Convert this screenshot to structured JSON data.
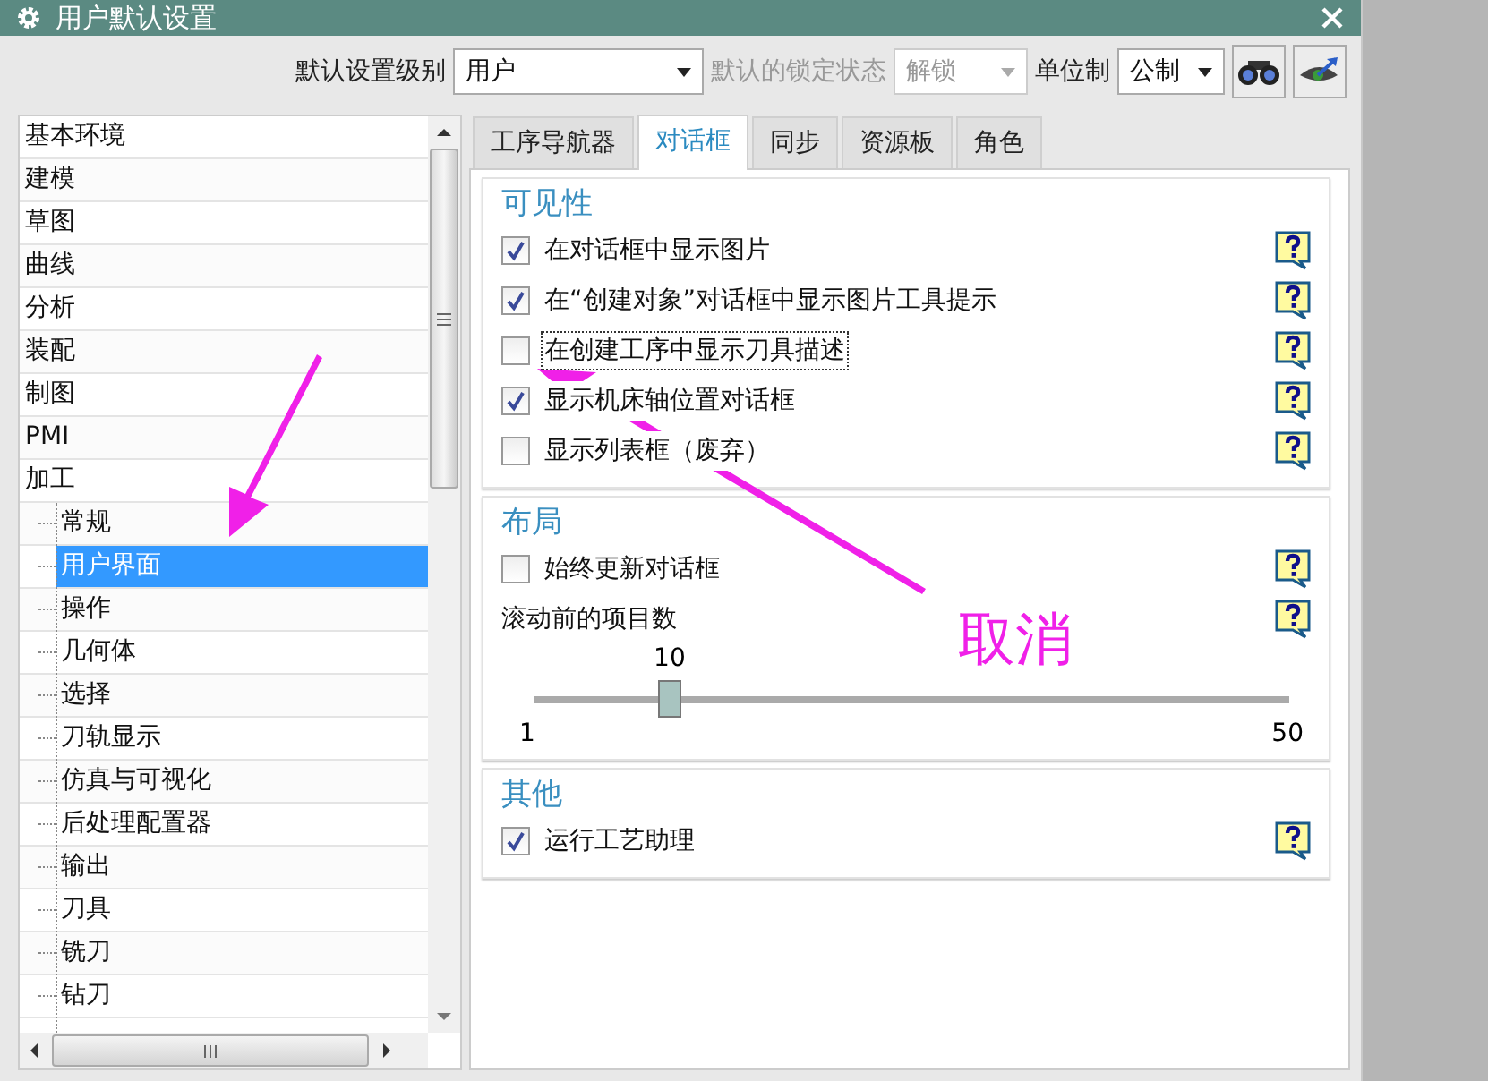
{
  "window": {
    "title": "用户默认设置"
  },
  "toolbar": {
    "level_label": "默认设置级别",
    "level_value": "用户",
    "lock_label": "默认的锁定状态",
    "lock_value": "解锁",
    "lock_disabled": true,
    "unit_label": "单位制",
    "unit_value": "公制"
  },
  "tree": [
    {
      "label": "基本环境",
      "selected": false
    },
    {
      "label": "建模",
      "selected": false
    },
    {
      "label": "草图",
      "selected": false
    },
    {
      "label": "曲线",
      "selected": false
    },
    {
      "label": "分析",
      "selected": false
    },
    {
      "label": "装配",
      "selected": false
    },
    {
      "label": "制图",
      "selected": false
    },
    {
      "label": "PMI",
      "selected": false
    },
    {
      "label": "加工",
      "selected": false,
      "children": [
        {
          "label": "常规",
          "selected": false
        },
        {
          "label": "用户界面",
          "selected": true
        },
        {
          "label": "操作",
          "selected": false
        },
        {
          "label": "几何体",
          "selected": false
        },
        {
          "label": "选择",
          "selected": false
        },
        {
          "label": "刀轨显示",
          "selected": false
        },
        {
          "label": "仿真与可视化",
          "selected": false
        },
        {
          "label": "后处理配置器",
          "selected": false
        },
        {
          "label": "输出",
          "selected": false
        },
        {
          "label": "刀具",
          "selected": false
        },
        {
          "label": "铣刀",
          "selected": false
        },
        {
          "label": "钻刀",
          "selected": false
        }
      ]
    }
  ],
  "tabs": [
    {
      "label": "工序导航器",
      "selected": false
    },
    {
      "label": "对话框",
      "selected": true
    },
    {
      "label": "同步",
      "selected": false
    },
    {
      "label": "资源板",
      "selected": false
    },
    {
      "label": "角色",
      "selected": false
    }
  ],
  "sections": [
    {
      "title": "可见性",
      "items": [
        {
          "kind": "checkbox",
          "label": "在对话框中显示图片",
          "checked": true,
          "focused": false
        },
        {
          "kind": "checkbox",
          "label": "在“创建对象”对话框中显示图片工具提示",
          "checked": true,
          "focused": false
        },
        {
          "kind": "checkbox",
          "label": "在创建工序中显示刀具描述",
          "checked": false,
          "focused": true
        },
        {
          "kind": "checkbox",
          "label": "显示机床轴位置对话框",
          "checked": true,
          "focused": false
        },
        {
          "kind": "checkbox",
          "label": "显示列表框（废弃）",
          "checked": false,
          "focused": false
        }
      ]
    },
    {
      "title": "布局",
      "items": [
        {
          "kind": "checkbox",
          "label": "始终更新对话框",
          "checked": false,
          "focused": false
        },
        {
          "kind": "slider",
          "label": "滚动前的项目数",
          "value": "10",
          "min": "1",
          "max": "50",
          "level": 0.18
        }
      ]
    },
    {
      "title": "其他",
      "items": [
        {
          "kind": "checkbox",
          "label": "运行工艺助理",
          "checked": true,
          "focused": false
        }
      ]
    }
  ],
  "annotation": {
    "text": "取消"
  }
}
